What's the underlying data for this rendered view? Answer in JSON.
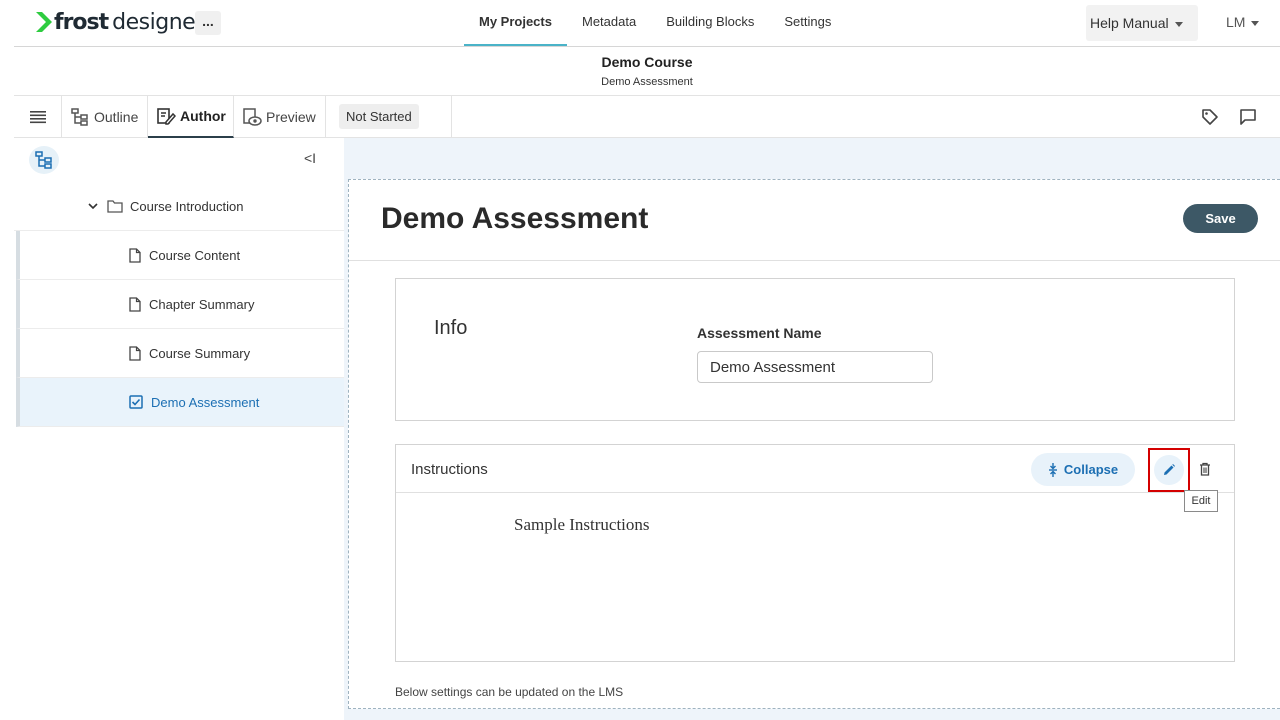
{
  "app": {
    "logo_bold": "frost",
    "logo_light": "designer",
    "more_label": "...",
    "nav_tabs": [
      {
        "label": "My Projects",
        "active": true
      },
      {
        "label": "Metadata",
        "active": false
      },
      {
        "label": "Building Blocks",
        "active": false
      },
      {
        "label": "Settings",
        "active": false
      }
    ],
    "help_label": "Help Manual",
    "user_initials": "LM",
    "accent_color": "#4ab3c8",
    "primary_color": "#3d5866"
  },
  "course": {
    "title": "Demo Course",
    "subtitle": "Demo Assessment"
  },
  "toolbar": {
    "menu_icon": "hamburger-icon",
    "tabs": [
      {
        "label": "Outline",
        "icon": "outline-tree-icon"
      },
      {
        "label": "Author",
        "icon": "author-edit-icon",
        "active": true
      },
      {
        "label": "Preview",
        "icon": "preview-eye-icon"
      }
    ],
    "status": "Not Started",
    "right_icons": [
      "tag-icon",
      "comment-icon"
    ]
  },
  "sidebar": {
    "collapse_glyph": "<I",
    "items": [
      {
        "label": "Course Introduction",
        "type": "folder",
        "expanded": true
      },
      {
        "label": "Course Content",
        "type": "page"
      },
      {
        "label": "Chapter Summary",
        "type": "page"
      },
      {
        "label": "Course Summary",
        "type": "page"
      },
      {
        "label": "Demo Assessment",
        "type": "assessment",
        "selected": true
      }
    ]
  },
  "main": {
    "title": "Demo Assessment",
    "save_label": "Save",
    "info": {
      "section_label": "Info",
      "field_label": "Assessment Name",
      "field_value": "Demo Assessment"
    },
    "instructions": {
      "title": "Instructions",
      "collapse_label": "Collapse",
      "edit_tooltip": "Edit",
      "body": "Sample Instructions"
    },
    "lms_note": "Below settings can be updated on the LMS"
  }
}
